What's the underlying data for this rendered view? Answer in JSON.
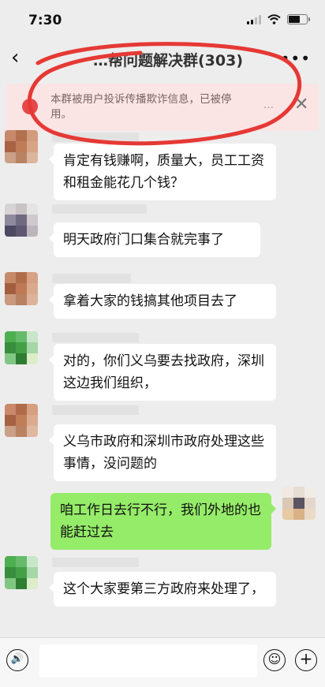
{
  "status_bar": {
    "time": "7:30"
  },
  "nav": {
    "back_icon": "‹",
    "title": "…帮问题解决群(303)",
    "more_icon": "•••"
  },
  "warning": {
    "icon": "!",
    "text": "本群被用户投诉传播欺诈信息，已被停用。",
    "dots": "…",
    "close_icon": "✕"
  },
  "messages": [
    {
      "side": "left",
      "text": "肯定有钱赚啊，质量大，员工工资和租金能花几个钱？"
    },
    {
      "side": "left",
      "text": "明天政府门口集合就完事了"
    },
    {
      "side": "left",
      "text": "拿着大家的钱搞其他项目去了"
    },
    {
      "side": "left",
      "text": "对的，你们义乌要去找政府，深圳这边我们组织，"
    },
    {
      "side": "left",
      "text": "义乌市政府和深圳市政府处理这些事情，没问题的"
    },
    {
      "side": "right",
      "text": "咱工作日去行不行，我们外地的也能赶过去"
    },
    {
      "side": "left",
      "text": "这个大家要第三方政府来处理了，"
    }
  ],
  "input_bar": {
    "voice_icon": "🔊",
    "emoji_icon": "☺",
    "plus_icon": "+"
  },
  "colors": {
    "background": "#ededed",
    "self_bubble": "#95ec69",
    "warning_bg": "#fbe4e4",
    "warning_icon": "#e5474a",
    "annotation_red": "#e53935"
  }
}
